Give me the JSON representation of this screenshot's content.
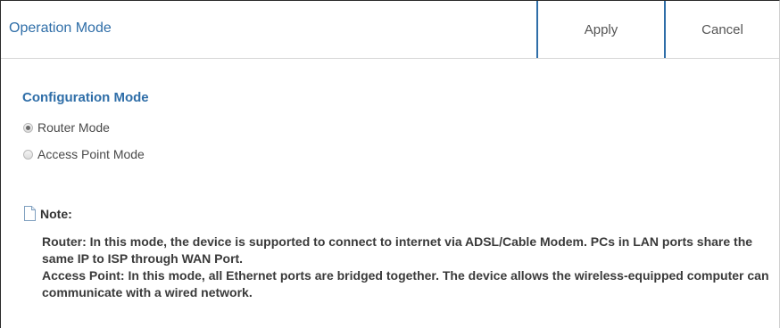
{
  "header": {
    "title": "Operation Mode",
    "apply_label": "Apply",
    "cancel_label": "Cancel"
  },
  "config": {
    "section_title": "Configuration Mode",
    "options": [
      {
        "label": "Router Mode",
        "selected": true
      },
      {
        "label": "Access Point Mode",
        "selected": false
      }
    ]
  },
  "note": {
    "label": "Note:",
    "lines": [
      "Router: In this mode, the device is supported to connect to internet via ADSL/Cable Modem. PCs in LAN ports share the same IP to ISP through WAN Port.",
      "Access Point: In this mode, all Ethernet ports are bridged together. The device allows the wireless-equipped computer can communicate with a wired network."
    ]
  },
  "colors": {
    "accent": "#2f6ea8"
  }
}
